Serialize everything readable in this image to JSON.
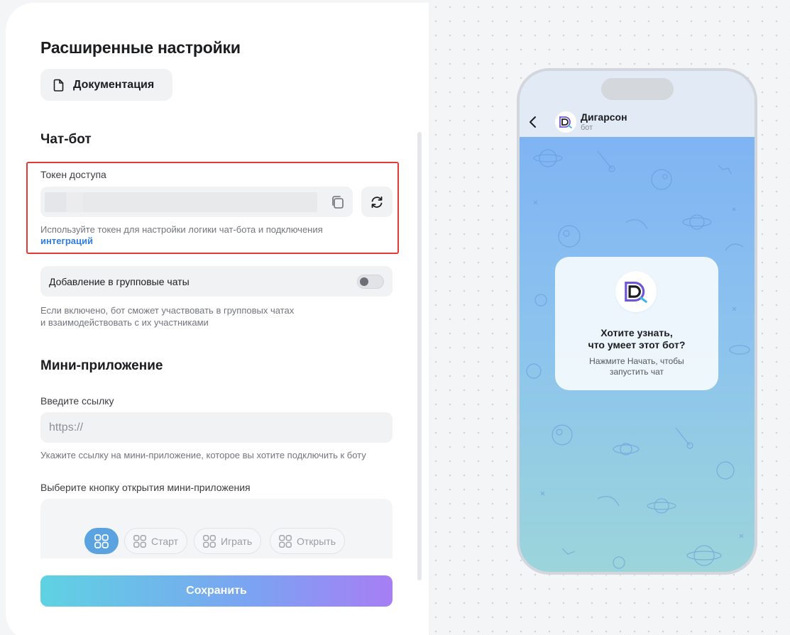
{
  "page": {
    "title": "Расширенные настройки",
    "docs_button": "Документация"
  },
  "chatbot": {
    "section_title": "Чат-бот",
    "token_label": "Токен доступа",
    "token_hint": "Используйте токен для настройки логики чат-бота и подключения",
    "token_hint_link": "интеграций",
    "group_toggle_label": "Добавление в групповые чаты",
    "group_toggle_on": false,
    "group_hint_line1": "Если включено, бот сможет участвовать в групповых чатах",
    "group_hint_line2": "и взаимодействовать с их участниками"
  },
  "mini_app": {
    "section_title": "Мини-приложение",
    "url_label": "Введите ссылку",
    "url_placeholder": "https://",
    "url_hint": "Укажите ссылку на мини-приложение, которое вы хотите подключить к боту",
    "button_label": "Выберите кнопку открытия мини-приложения",
    "button_options": [
      "Старт",
      "Играть",
      "Открыть"
    ]
  },
  "save_button": "Сохранить",
  "preview": {
    "bot_name": "Дигарсон",
    "bot_status": "бот",
    "card_title_line1": "Хотите узнать,",
    "card_title_line2": "что умеет этот бот?",
    "card_sub_line1": "Нажмите Начать, чтобы",
    "card_sub_line2": "запустить чат"
  },
  "colors": {
    "accent_blue": "#2f7de1",
    "highlight_frame": "#e53935",
    "selected_chip": "#5aa3e0"
  }
}
